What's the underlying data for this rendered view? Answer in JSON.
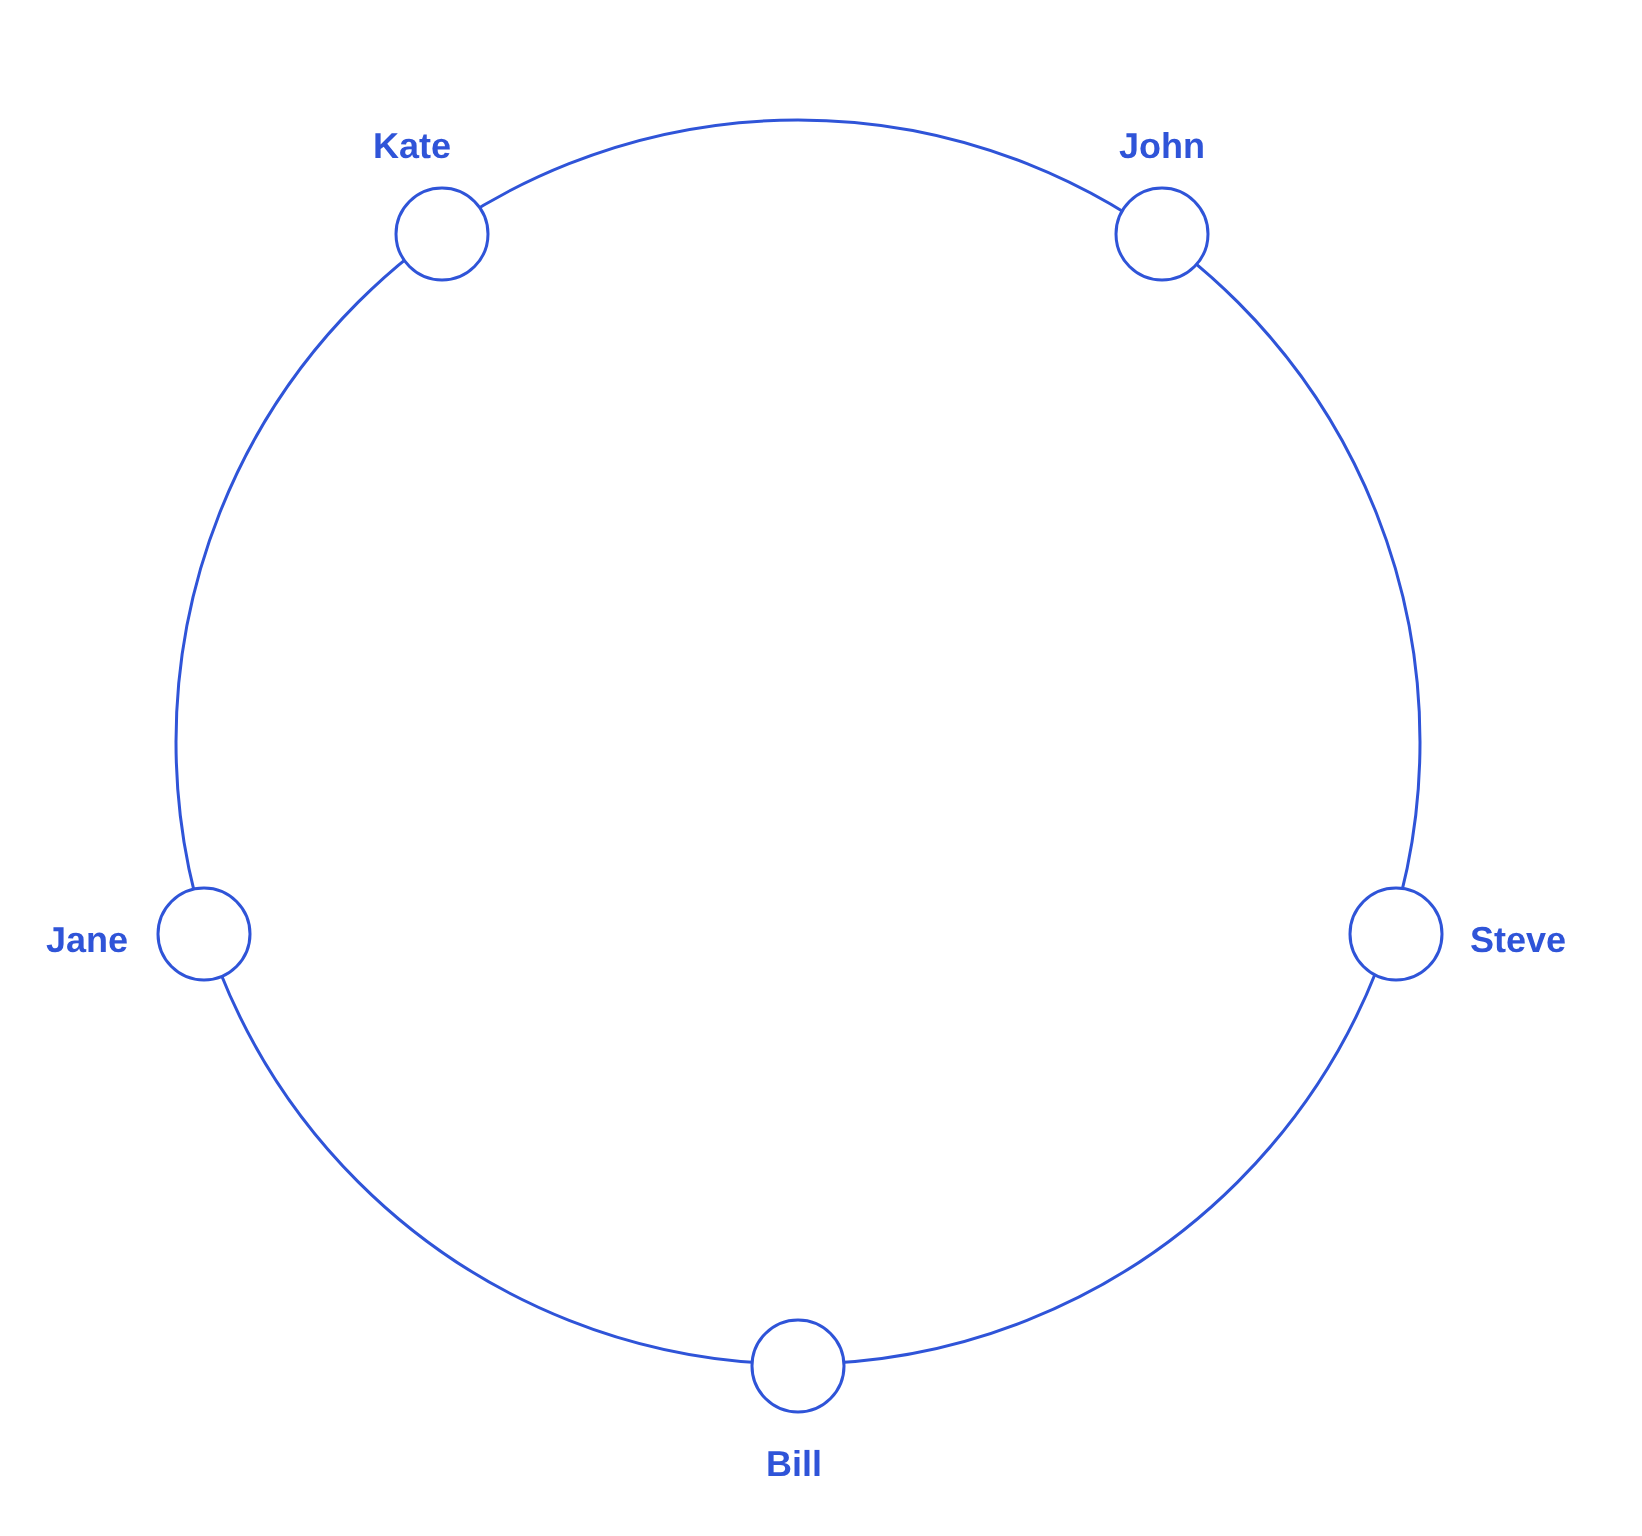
{
  "diagram": {
    "nodes": [
      {
        "label": "Kate"
      },
      {
        "label": "John"
      },
      {
        "label": "Jane"
      },
      {
        "label": "Steve"
      },
      {
        "label": "Bill"
      }
    ]
  }
}
